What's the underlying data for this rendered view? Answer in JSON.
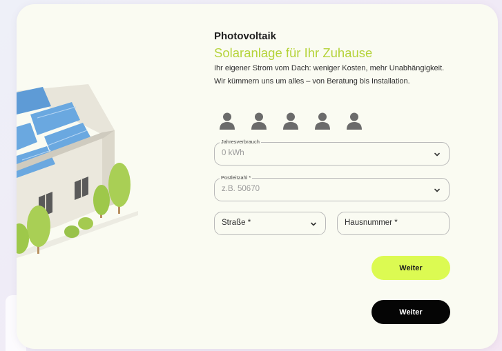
{
  "header": {
    "title": "Photovoltaik",
    "subtitle": "Solaranlage für Ihr Zuhause",
    "description": "Ihr eigener Strom vom Dach: weniger Kosten, mehr Unabhängigkeit. Wir kümmern uns um alles – von Beratung bis Installation."
  },
  "household": {
    "icon": "person-icon",
    "count_options": 5
  },
  "form": {
    "jahresverbrauch": {
      "label": "Jahresverbrauch",
      "value": "0 kWh"
    },
    "postleitzahl": {
      "label": "Postleitzahl *",
      "placeholder": "z.B. 50670"
    },
    "strasse": {
      "placeholder": "Straße *"
    },
    "hausnummer": {
      "placeholder": "Hausnummer *"
    }
  },
  "buttons": {
    "primary_label": "Weiter",
    "secondary_label": "Weiter"
  },
  "colors": {
    "accent_lime": "#dcfa52",
    "subtitle_green": "#b5d33a",
    "dark_button": "#050505",
    "card_background": "#fafbf2"
  }
}
